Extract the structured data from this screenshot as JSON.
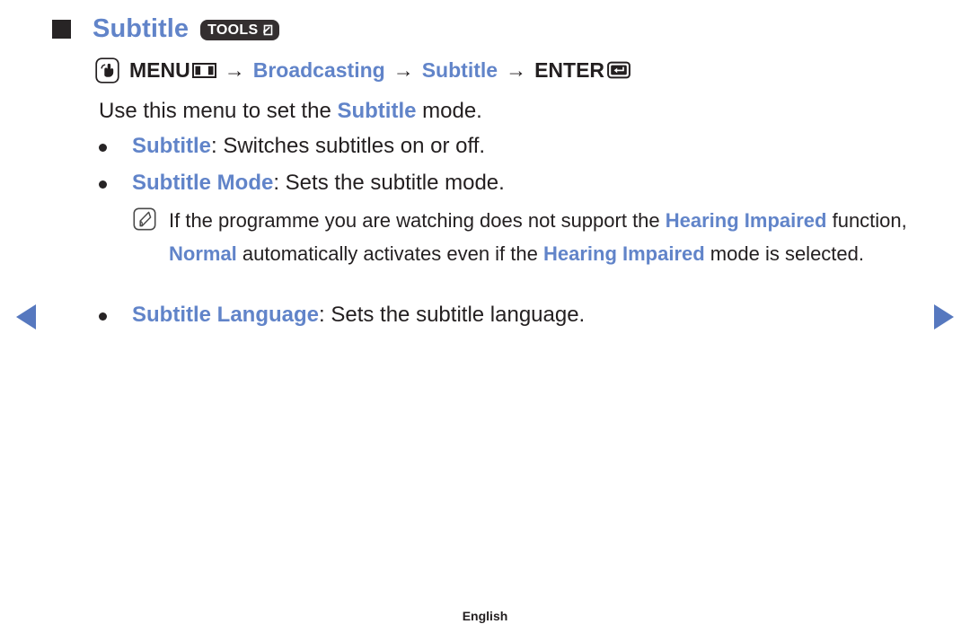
{
  "page": {
    "title": "Subtitle",
    "tools_badge_label": "TOOLS",
    "footer_language": "English",
    "accent_blue": "#6184c9",
    "arrow_blue": "#5678bf",
    "text_black": "#231f20",
    "badge_dark": "#342f30"
  },
  "menu_path": {
    "touch_icon": "hand-press-icon",
    "step1": "MENU",
    "menu_icon": "menu-grid-icon",
    "sep1": "→",
    "step2": "Broadcasting",
    "sep2": "→",
    "step3": "Subtitle",
    "sep3": "→",
    "step4": "ENTER",
    "enter_icon": "enter-key-icon"
  },
  "intro": {
    "part1": "Use this menu to set the ",
    "term": "Subtitle",
    "part2": " mode."
  },
  "bullets": [
    {
      "term": "Subtitle",
      "description": ": Switches subtitles on or off."
    },
    {
      "term": "Subtitle Mode",
      "description": ": Sets the subtitle mode."
    },
    {
      "term": "Subtitle Language",
      "description": ": Sets the subtitle language."
    }
  ],
  "note": {
    "icon": "note-pencil-icon",
    "t1": "If the programme you are watching does not support the ",
    "b1": "Hearing Impaired",
    "t2": " function, ",
    "b2": "Normal",
    "t3": " automatically activates even if the ",
    "b3": "Hearing Impaired",
    "t4": " mode is selected."
  },
  "navigation": {
    "prev_label": "previous-page",
    "next_label": "next-page"
  }
}
